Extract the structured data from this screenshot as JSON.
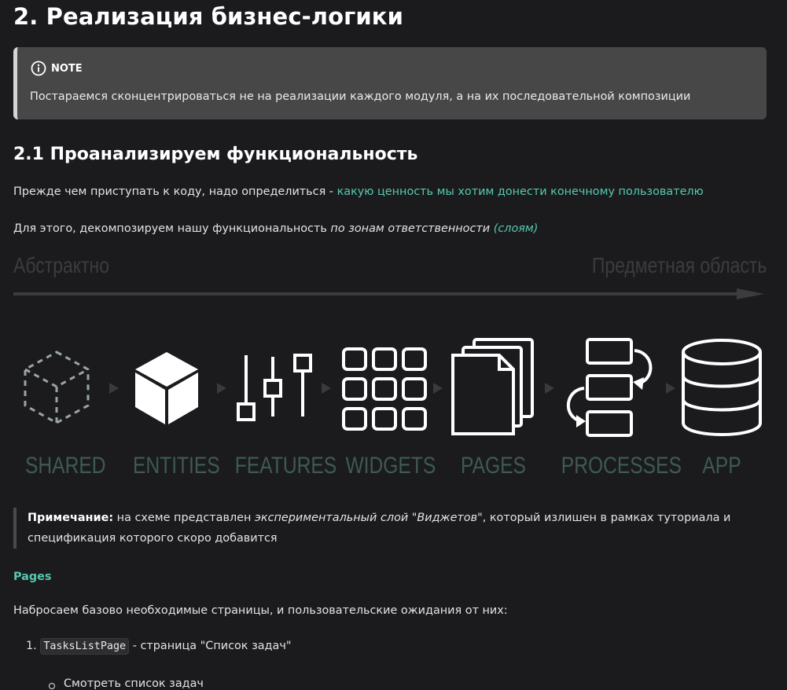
{
  "heading": "2. Реализация бизнес-логики",
  "note": {
    "label": "NOTE",
    "text": "Постараемся сконцентрироваться не на реализации каждого модуля, а на их последовательной композиции"
  },
  "section": {
    "title": "2.1 Проанализируем функциональность",
    "p1_text": "Прежде чем приступать к коду, надо определиться - ",
    "p1_link": "какую ценность мы хотим донести конечному пользователю",
    "p2_text": "Для этого, декомпозируем нашу функциональность ",
    "p2_em": "по зонам ответственности",
    "p2_em_teal": "(слоям)"
  },
  "diagram": {
    "axis_left": "Абстрактно",
    "axis_right": "Предметная область",
    "layers": [
      "SHARED",
      "ENTITIES",
      "FEATURES",
      "WIDGETS",
      "PAGES",
      "PROCESSES",
      "APP"
    ]
  },
  "quote": {
    "bold": "Примечание:",
    "t1": " на схеме представлен ",
    "em": "экспериментальный слой \"Виджетов\"",
    "t2": ", который излишен в рамках туториала и спецификация которого скоро добавится"
  },
  "pages_heading": "Pages",
  "pages_intro": "Набросаем базово необходимые страницы, и пользовательские ожидания от них:",
  "list": {
    "number": "1.",
    "code": "TasksListPage",
    "text": " - страница \"Список задач\"",
    "sub": "Смотреть список задач"
  },
  "colors": {
    "background": "#1b1b1d",
    "accent": "#55c9b0",
    "layer_label": "#3e5a52",
    "note_bg": "#474748"
  }
}
